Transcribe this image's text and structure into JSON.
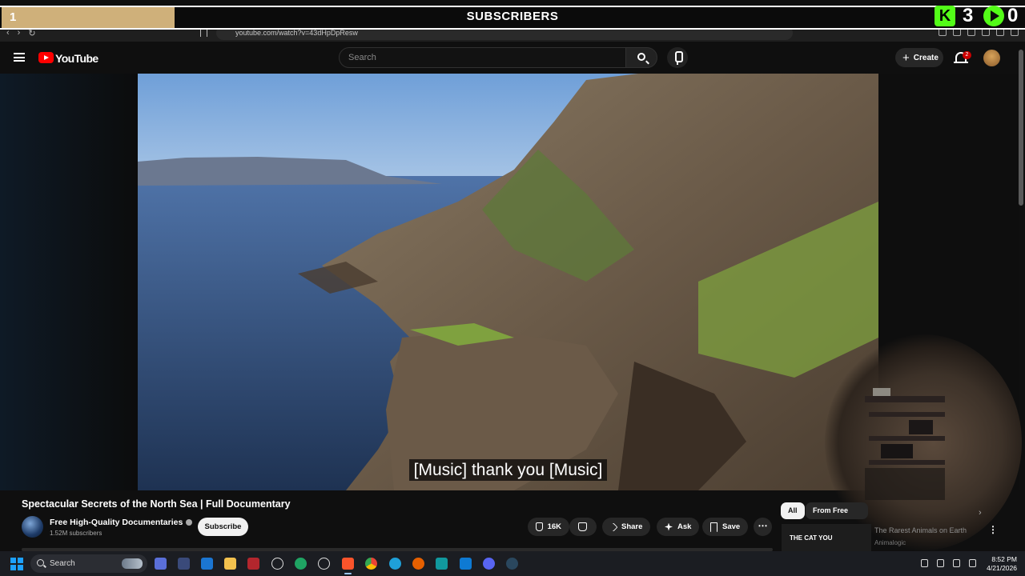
{
  "overlay": {
    "goal_count": "1",
    "goal_title": "SUBSCRIBERS",
    "kick_logo": "K",
    "kick_count": "3",
    "play_count": "0"
  },
  "browser": {
    "url": "youtube.com/watch?v=43dHpDpResw",
    "nav_icons": [
      "back-icon",
      "forward-icon",
      "reload-icon",
      "bookmark-icon"
    ]
  },
  "youtube": {
    "logo_text": "YouTube",
    "search_placeholder": "Search",
    "create_label": "Create",
    "notification_count": "2",
    "caption": "[Music] thank you [Music]",
    "video_title": "Spectacular Secrets of the North Sea | Full Documentary",
    "channel_name": "Free High-Quality Documentaries",
    "channel_subs": "1.52M subscribers",
    "subscribe_label": "Subscribe",
    "like_count": "16K",
    "share_label": "Share",
    "ask_label": "Ask",
    "save_label": "Save",
    "chips": [
      "All",
      "From Free"
    ],
    "rec": {
      "thumb_text": "THE CAT YOU",
      "title": "The Rarest Animals on Earth",
      "channel": "Animalogic"
    }
  },
  "taskbar": {
    "search_label": "Search",
    "time": "8:52 PM",
    "date": "4/21/2026"
  },
  "colors": {
    "accent_red": "#ff0000",
    "goal_bar": "#cfb07a",
    "kick_green": "#53fc18",
    "background": "#0f0f0f"
  }
}
